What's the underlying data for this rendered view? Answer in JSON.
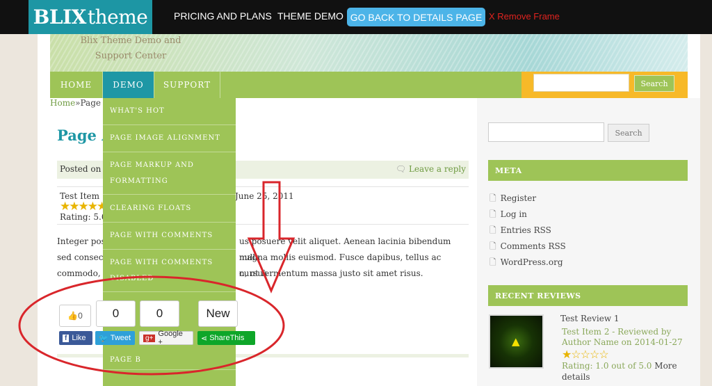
{
  "topbar": {
    "logo_bold": "BLIX",
    "logo_thin": "theme",
    "pricing": "PRICING AND PLANS",
    "theme_demo": "THEME DEMO",
    "back_button": "GO BACK TO DETAILS PAGE",
    "remove_frame": "X Remove Frame"
  },
  "header": {
    "tagline": "Blix Theme Demo and Support Center"
  },
  "nav": {
    "items": [
      "HOME",
      "DEMO",
      "SUPPORT"
    ],
    "search_button": "Search"
  },
  "dropdown": {
    "items": [
      "WHAT'S HOT",
      "PAGE IMAGE ALIGNMENT",
      "PAGE MARKUP AND FORMATTING",
      "CLEARING FLOATS",
      "PAGE WITH COMMENTS",
      "PAGE WITH COMMENTS DISABLED",
      "PAGE B"
    ]
  },
  "breadcrumb": {
    "home": "Home",
    "sep": "»",
    "current": "Page"
  },
  "post": {
    "title": "Page A",
    "posted_on": "Posted on",
    "leave_reply": "Leave a reply",
    "review_item": "Test Item",
    "review_date": "June 25, 2011",
    "rating": "Rating: 5.0",
    "stars": "★★★★★",
    "body_1": "Integer pos",
    "body_1b": "us posuere velit aliquet. Aenean lacinia bibendum nulla",
    "body_2": "sed consect",
    "body_2b": "magna mollis euismod. Fusce dapibus, tellus ac cursus",
    "body_3": "commodo, ",
    "body_3b": "n, ut fermentum massa justo sit amet risus."
  },
  "share": {
    "like_count": "0",
    "tweet_count": "0",
    "google_count": "0",
    "sharethis_count": "New",
    "fb_label": "Like",
    "tweet_label": "Tweet",
    "google_label": "Google +",
    "sharethis_label": "ShareThis"
  },
  "sidebar": {
    "search_button": "Search",
    "meta_title": "META",
    "meta_items": [
      "Register",
      "Log in",
      "Entries RSS",
      "Comments RSS",
      "WordPress.org"
    ],
    "reviews_title": "RECENT REVIEWS",
    "review_title": "Test Review 1",
    "review_sub": "Test Item 2 - Reviewed by Author Name on 2014-01-27",
    "review_stars": "★☆☆☆☆",
    "review_rating": "Rating: 1.0 out of 5.0",
    "review_more": "More details"
  },
  "colors": {
    "accent_teal": "#1e97a5",
    "nav_green": "#9ec457",
    "search_orange": "#f7b928",
    "annotation_red": "#d9262b"
  }
}
